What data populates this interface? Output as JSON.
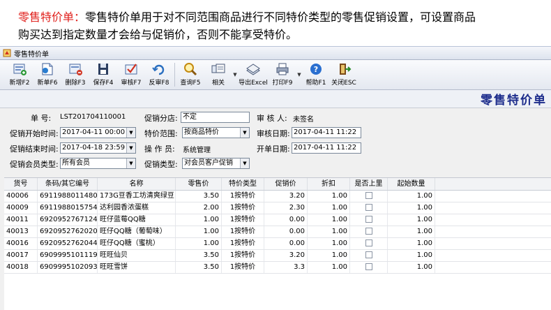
{
  "intro": {
    "highlight": "零售特价单：",
    "line1": "零售特价单用于对不同范围商品进行不同特价类型的零售促销设置，可设置商品",
    "line2": "购买达到指定数量才会给与促销价，否则不能享受特价。"
  },
  "window": {
    "title": "零售特价单"
  },
  "toolbar": {
    "items": [
      {
        "name": "new-add-button",
        "label": "新增F2",
        "icon": "new-add-icon"
      },
      {
        "name": "new-doc-button",
        "label": "新单F6",
        "icon": "new-doc-icon"
      },
      {
        "name": "delete-button",
        "label": "删除F3",
        "icon": "delete-icon"
      },
      {
        "name": "save-button",
        "label": "保存F4",
        "icon": "save-icon"
      },
      {
        "name": "approve-button",
        "label": "审核F7",
        "icon": "approve-icon"
      },
      {
        "name": "unapprove-button",
        "label": "反审F8",
        "icon": "unapprove-icon"
      },
      {
        "name": "query-button",
        "label": "查询F5",
        "icon": "search-icon"
      },
      {
        "name": "related-button",
        "label": "相关",
        "icon": "related-icon"
      },
      {
        "name": "export-excel-button",
        "label": "导出Excel",
        "icon": "excel-icon"
      },
      {
        "name": "print-button",
        "label": "打印F9",
        "icon": "print-icon"
      },
      {
        "name": "help-button",
        "label": "帮助F1",
        "icon": "help-icon"
      },
      {
        "name": "close-button",
        "label": "关闭ESC",
        "icon": "exit-icon"
      }
    ]
  },
  "document": {
    "title": "零售特价单",
    "fields": {
      "doc_no_label": "单    号:",
      "doc_no": "LST201704110001",
      "branch_label": "促销分店:",
      "branch": "不定",
      "approver_label": "审 核 人:",
      "approver": "未签名",
      "start_label": "促销开始时间:",
      "start": "2017-04-11 00:00",
      "range_label": "特价范围:",
      "range": "按商品特价",
      "approve_date_label": "审核日期:",
      "approve_date": "2017-04-11 11:22",
      "end_label": "促销结束时间:",
      "end": "2017-04-18 23:59",
      "operator_label": "操 作 员:",
      "operator": "系统管理",
      "bill_date_label": "开单日期:",
      "bill_date": "2017-04-11 11:22",
      "member_type_label": "促销会员类型:",
      "member_type": "所有会员",
      "promo_type_label": "促销类型:",
      "promo_type": "对会员客户促销"
    }
  },
  "table": {
    "columns": [
      "货号",
      "条码/其它编号",
      "名称",
      "零售价",
      "特价类型",
      "促销价",
      "折扣",
      "是否上里",
      "起始数量"
    ],
    "rows": [
      [
        "40006",
        "6911988011480",
        "173G豆香工坊清爽绿豆",
        "3.50",
        "1按特价",
        "3.20",
        "1.00",
        "",
        "1.00"
      ],
      [
        "40009",
        "6911988015754",
        "达利园香浓蛋糕",
        "2.00",
        "1按特价",
        "2.30",
        "1.00",
        "",
        "1.00"
      ],
      [
        "40011",
        "6920952767124",
        "旺仔蓝莓QQ糖",
        "1.00",
        "1按特价",
        "0.00",
        "1.00",
        "",
        "1.00"
      ],
      [
        "40013",
        "6920952762020",
        "旺仔QQ糖（葡萄味）",
        "1.00",
        "1按特价",
        "0.00",
        "1.00",
        "",
        "1.00"
      ],
      [
        "40016",
        "6920952762044",
        "旺仔QQ糖（蜜桃）",
        "1.00",
        "1按特价",
        "0.00",
        "1.00",
        "",
        "1.00"
      ],
      [
        "40017",
        "6909995101119",
        "旺旺仙贝",
        "3.50",
        "1按特价",
        "3.20",
        "1.00",
        "",
        "1.00"
      ],
      [
        "40018",
        "6909995102093",
        "旺旺雪饼",
        "3.50",
        "1按特价",
        "3.3",
        "1.00",
        "",
        "1.00"
      ]
    ]
  }
}
